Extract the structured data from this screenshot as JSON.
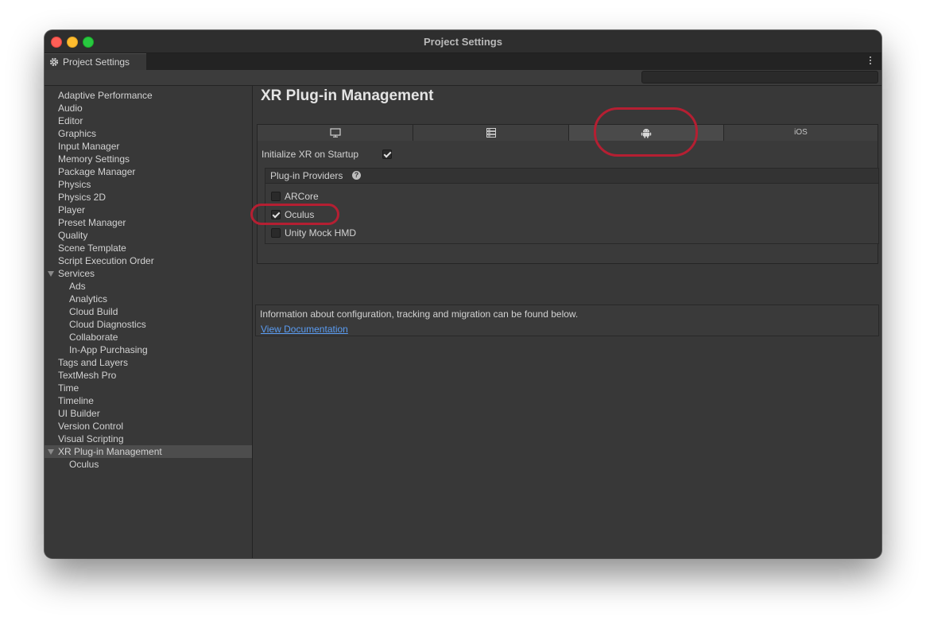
{
  "window": {
    "title": "Project Settings",
    "tab_label": "Project Settings"
  },
  "search": {
    "value": "",
    "placeholder": ""
  },
  "sidebar": {
    "items": [
      {
        "label": "Adaptive Performance",
        "indent": 0
      },
      {
        "label": "Audio",
        "indent": 0
      },
      {
        "label": "Editor",
        "indent": 0
      },
      {
        "label": "Graphics",
        "indent": 0
      },
      {
        "label": "Input Manager",
        "indent": 0
      },
      {
        "label": "Memory Settings",
        "indent": 0
      },
      {
        "label": "Package Manager",
        "indent": 0
      },
      {
        "label": "Physics",
        "indent": 0
      },
      {
        "label": "Physics 2D",
        "indent": 0
      },
      {
        "label": "Player",
        "indent": 0
      },
      {
        "label": "Preset Manager",
        "indent": 0
      },
      {
        "label": "Quality",
        "indent": 0
      },
      {
        "label": "Scene Template",
        "indent": 0
      },
      {
        "label": "Script Execution Order",
        "indent": 0
      },
      {
        "label": "Services",
        "indent": 0,
        "expanded": true
      },
      {
        "label": "Ads",
        "indent": 1
      },
      {
        "label": "Analytics",
        "indent": 1
      },
      {
        "label": "Cloud Build",
        "indent": 1
      },
      {
        "label": "Cloud Diagnostics",
        "indent": 1
      },
      {
        "label": "Collaborate",
        "indent": 1
      },
      {
        "label": "In-App Purchasing",
        "indent": 1
      },
      {
        "label": "Tags and Layers",
        "indent": 0
      },
      {
        "label": "TextMesh Pro",
        "indent": 0
      },
      {
        "label": "Time",
        "indent": 0
      },
      {
        "label": "Timeline",
        "indent": 0
      },
      {
        "label": "UI Builder",
        "indent": 0
      },
      {
        "label": "Version Control",
        "indent": 0
      },
      {
        "label": "Visual Scripting",
        "indent": 0
      },
      {
        "label": "XR Plug-in Management",
        "indent": 0,
        "expanded": true,
        "selected": true
      },
      {
        "label": "Oculus",
        "indent": 1
      }
    ]
  },
  "main": {
    "title": "XR Plug-in Management",
    "platform_tabs": [
      {
        "icon": "monitor-icon",
        "label": ""
      },
      {
        "icon": "server-icon",
        "label": ""
      },
      {
        "icon": "android-icon",
        "label": "",
        "active": true
      },
      {
        "icon": "",
        "label": "iOS"
      }
    ],
    "init_label": "Initialize XR on Startup",
    "init_checked": true,
    "providers_title": "Plug-in Providers",
    "providers": [
      {
        "label": "ARCore",
        "checked": false
      },
      {
        "label": "Oculus",
        "checked": true
      },
      {
        "label": "Unity Mock HMD",
        "checked": false
      }
    ],
    "info_text": "Information about configuration, tracking and migration can be found below.",
    "doc_link": "View Documentation"
  },
  "colors": {
    "accent_link": "#5a9cf2",
    "annotation": "#b51f32",
    "background": "#383838"
  }
}
